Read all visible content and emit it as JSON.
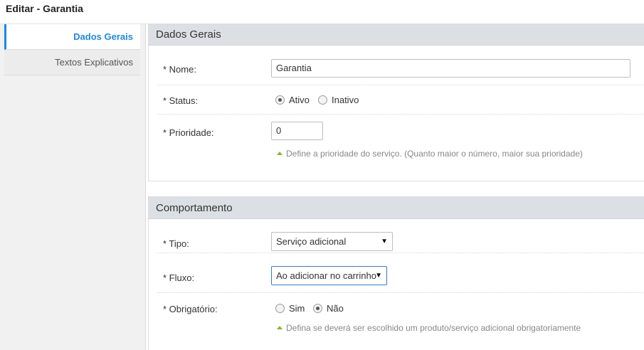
{
  "header": {
    "title": "Editar - Garantia"
  },
  "sidebar": {
    "items": [
      {
        "label": "Dados Gerais"
      },
      {
        "label": "Textos Explicativos"
      }
    ]
  },
  "dados_gerais": {
    "title": "Dados Gerais",
    "nome": {
      "label": "* Nome:",
      "value": "Garantia"
    },
    "status": {
      "label": "* Status:",
      "options": [
        "Ativo",
        "Inativo"
      ],
      "selected": "Ativo"
    },
    "prioridade": {
      "label": "* Prioridade:",
      "value": "0",
      "hint": "Define a prioridade do serviço. (Quanto maior o número, maior sua prioridade)"
    }
  },
  "comportamento": {
    "title": "Comportamento",
    "tipo": {
      "label": "* Tipo:",
      "value": "Serviço adicional"
    },
    "fluxo": {
      "label": "* Fluxo:",
      "value": "Ao adicionar no carrinho"
    },
    "obrigatorio": {
      "label": "* Obrigatório:",
      "options": [
        "Sim",
        "Não"
      ],
      "selected": "Não",
      "hint": "Defina se deverá ser escolhido um produto/serviço adicional obrigatoriamente"
    }
  },
  "icons": {
    "caret": "▼",
    "hint_arrow": "up-triangle-icon",
    "accent": "#1e88e5",
    "hint_color": "#8bb52b"
  }
}
